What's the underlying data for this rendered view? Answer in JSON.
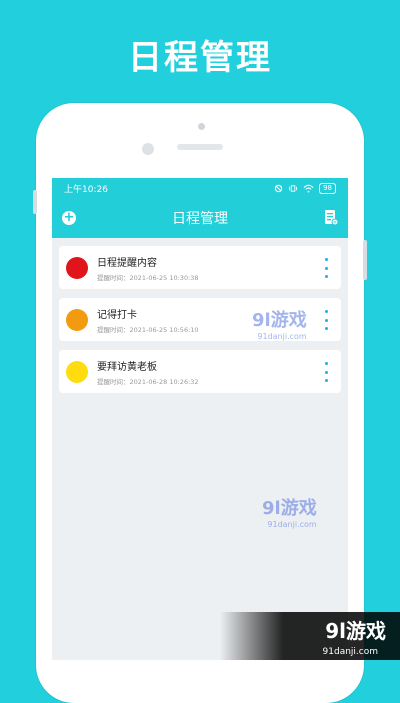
{
  "promo": {
    "title": "日程管理"
  },
  "status_bar": {
    "time": "上午10:26",
    "battery": "98"
  },
  "app_bar": {
    "title": "日程管理"
  },
  "colors": {
    "accent": "#22cfd9",
    "more": "#22aee5"
  },
  "icons": {
    "add": "plus-circle-icon",
    "edit": "document-edit-icon",
    "more": "more-vertical-icon"
  },
  "reminders": [
    {
      "title": "日程提醒内容",
      "time": "提醒时间：2021-06-25 10:30:38",
      "color": "#e0141b"
    },
    {
      "title": "记得打卡",
      "time": "提醒时间：2021-06-25 10:56:10",
      "color": "#f39b10"
    },
    {
      "title": "要拜访黄老板",
      "time": "提醒时间：2021-06-28 10:26:32",
      "color": "#ffdc10"
    }
  ],
  "watermark": {
    "brand": "9l游戏",
    "domain": "91danji.com"
  }
}
